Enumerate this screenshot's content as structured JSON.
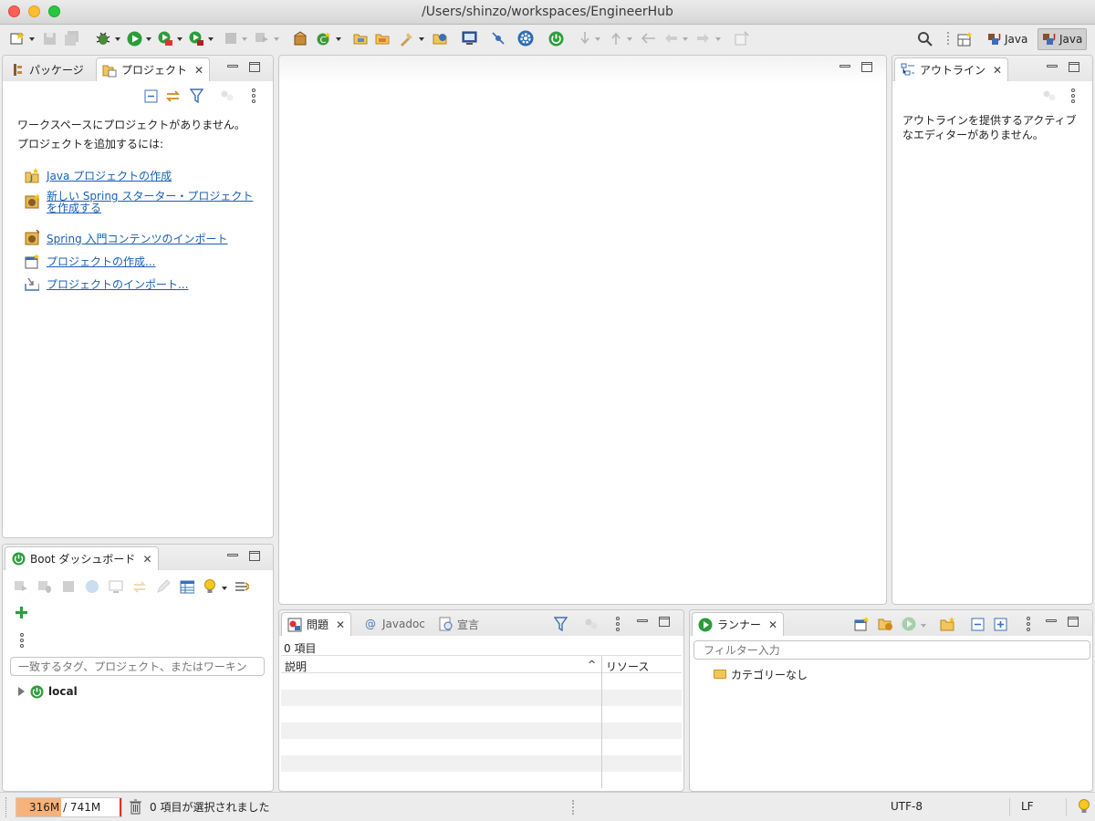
{
  "window": {
    "title": "/Users/shinzo/workspaces/EngineerHub"
  },
  "colors": {
    "accent": "#1a5fb4",
    "spring_green": "#2e9e3e",
    "run_green": "#2a9d3a",
    "heap_fill": "#f6b27a"
  },
  "toolbar": {
    "perspectives": [
      {
        "label": "Java",
        "icon": "java-ee-perspective-icon"
      },
      {
        "label": "Java",
        "icon": "java-perspective-icon",
        "active": true
      }
    ]
  },
  "package_explorer": {
    "tabs": [
      {
        "label": "パッケージ",
        "icon": "package-explorer-icon"
      },
      {
        "label": "プロジェクト",
        "icon": "project-explorer-icon"
      }
    ],
    "message_line1": "ワークスペースにプロジェクトがありません。",
    "message_line2": "プロジェクトを追加するには:",
    "links": [
      {
        "label": "Java プロジェクトの作成",
        "icon": "new-java-project-icon"
      },
      {
        "label_line1": "新しい Spring スターター・プロジェクト",
        "label_line2": "を作成する",
        "icon": "spring-starter-icon"
      },
      {
        "label": "Spring 入門コンテンツのインポート",
        "icon": "import-guides-icon"
      },
      {
        "label": "プロジェクトの作成...",
        "icon": "new-project-icon"
      },
      {
        "label": "プロジェクトのインポート...",
        "icon": "import-project-icon"
      }
    ]
  },
  "outline": {
    "tab": "アウトライン",
    "message_line1": "アウトラインを提供するアクティブ",
    "message_line2": "なエディターがありません。"
  },
  "boot_dashboard": {
    "tab": "Boot ダッシュボード",
    "filter_placeholder": "一致するタグ、プロジェクト、またはワーキン",
    "tree_items": [
      {
        "label": "local",
        "icon": "spring-boot-power-icon"
      }
    ]
  },
  "problems": {
    "tabs": [
      {
        "label": "問題",
        "icon": "problems-icon"
      },
      {
        "label": "Javadoc",
        "icon": "at-icon"
      },
      {
        "label": "宣言",
        "icon": "declaration-icon"
      }
    ],
    "count": "0 項目",
    "columns": [
      "説明",
      "リソース"
    ]
  },
  "runner": {
    "tab": "ランナー",
    "filter_placeholder": "フィルター入力",
    "tree_items": [
      {
        "label": "カテゴリーなし",
        "icon": "folder-icon"
      }
    ]
  },
  "statusbar": {
    "heap": "316M / 741M",
    "heap_used_fraction": 0.43,
    "selection": "0 項目が選択されました",
    "encoding": "UTF-8",
    "line_delimiter": "LF"
  }
}
